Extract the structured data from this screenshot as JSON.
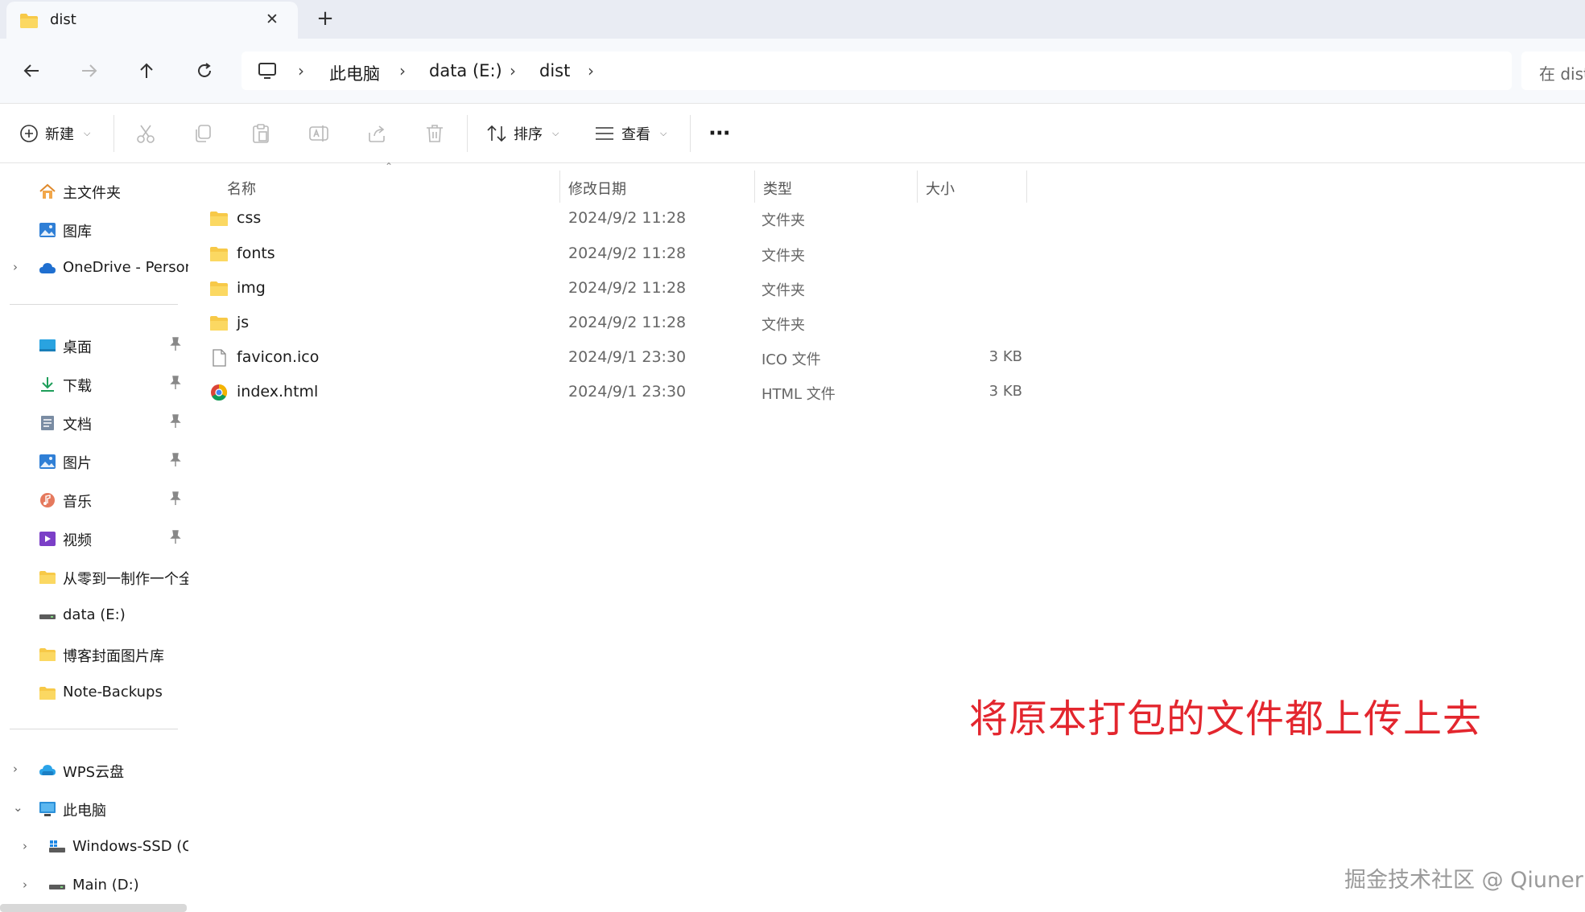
{
  "tab": {
    "title": "dist",
    "close_icon": "close-icon",
    "new_tab_icon": "plus-icon"
  },
  "address": {
    "crumbs": [
      "此电脑",
      "data (E:)",
      "dist"
    ],
    "search_placeholder": "在 dist"
  },
  "toolbar": {
    "new_label": "新建",
    "sort_label": "排序",
    "view_label": "查看",
    "more_label": "···"
  },
  "nav": {
    "items": [
      {
        "label": "主文件夹",
        "icon": "home-icon"
      },
      {
        "label": "图库",
        "icon": "gallery-icon"
      },
      {
        "label": "OneDrive - Personal",
        "icon": "cloud-icon"
      },
      {
        "label": "桌面",
        "icon": "desktop-icon"
      },
      {
        "label": "下载",
        "icon": "download-icon"
      },
      {
        "label": "文档",
        "icon": "document-icon"
      },
      {
        "label": "图片",
        "icon": "picture-icon"
      },
      {
        "label": "音乐",
        "icon": "music-icon"
      },
      {
        "label": "视频",
        "icon": "video-icon"
      },
      {
        "label": "从零到一制作一个全",
        "icon": "folder-icon"
      },
      {
        "label": "data (E:)",
        "icon": "drive-icon"
      },
      {
        "label": "博客封面图片库",
        "icon": "folder-icon"
      },
      {
        "label": "Note-Backups",
        "icon": "folder-icon"
      },
      {
        "label": "WPS云盘",
        "icon": "wps-cloud-icon"
      },
      {
        "label": "此电脑",
        "icon": "computer-icon"
      },
      {
        "label": "Windows-SSD (C:)",
        "icon": "windows-drive-icon"
      },
      {
        "label": "Main (D:)",
        "icon": "drive-icon"
      }
    ]
  },
  "columns": {
    "name": "名称",
    "date": "修改日期",
    "type": "类型",
    "size": "大小"
  },
  "files": [
    {
      "name": "css",
      "date": "2024/9/2 11:28",
      "type": "文件夹",
      "size": "",
      "icon": "folder-icon"
    },
    {
      "name": "fonts",
      "date": "2024/9/2 11:28",
      "type": "文件夹",
      "size": "",
      "icon": "folder-icon"
    },
    {
      "name": "img",
      "date": "2024/9/2 11:28",
      "type": "文件夹",
      "size": "",
      "icon": "folder-icon"
    },
    {
      "name": "js",
      "date": "2024/9/2 11:28",
      "type": "文件夹",
      "size": "",
      "icon": "folder-icon"
    },
    {
      "name": "favicon.ico",
      "date": "2024/9/1 23:30",
      "type": "ICO 文件",
      "size": "3 KB",
      "icon": "file-icon"
    },
    {
      "name": "index.html",
      "date": "2024/9/1 23:30",
      "type": "HTML 文件",
      "size": "3 KB",
      "icon": "chrome-icon"
    }
  ],
  "annotation": "将原本打包的文件都上传上去",
  "watermark": "掘金技术社区 @ Qiuner",
  "colors": {
    "annotation": "#e3262e",
    "folder": "#f7c948",
    "accent": "#0a64c8"
  }
}
